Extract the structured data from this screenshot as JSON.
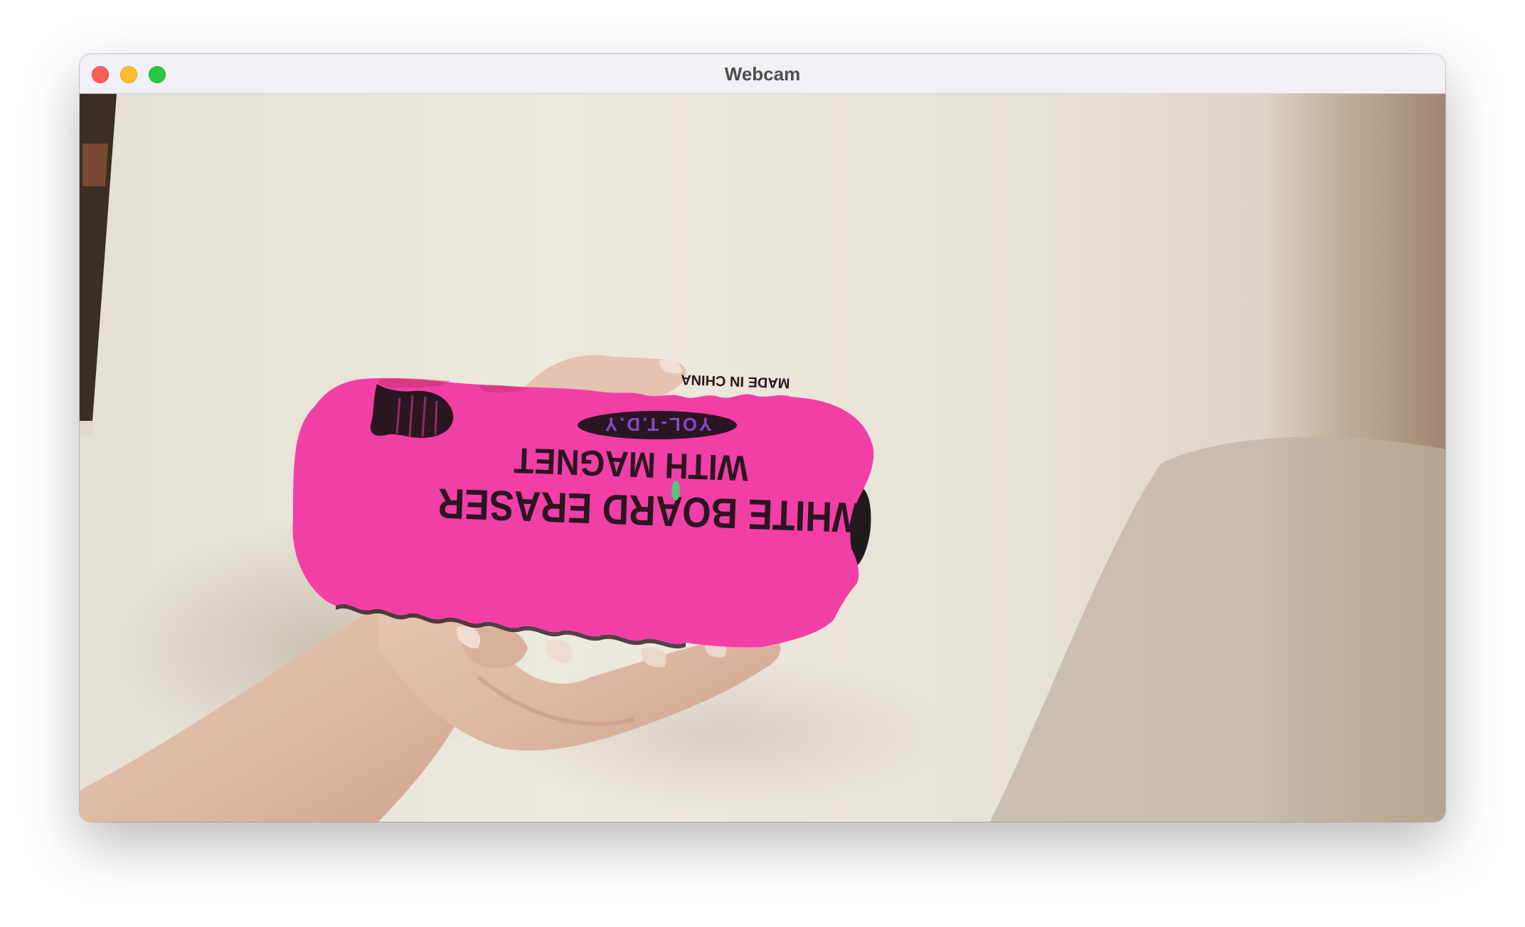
{
  "window": {
    "title": "Webcam"
  },
  "feed": {
    "eraser": {
      "line1": "WHITE BOARD ERASER",
      "line2": "WITH MAGNET",
      "brand": "YOL-T.D.Y",
      "origin": "MADE IN CHINA"
    }
  },
  "colors": {
    "eraser_pink": "#f23fa6",
    "wall": "#ece7da",
    "traffic_close": "#fe5f57",
    "traffic_min": "#febc2e",
    "traffic_max": "#28c840"
  }
}
